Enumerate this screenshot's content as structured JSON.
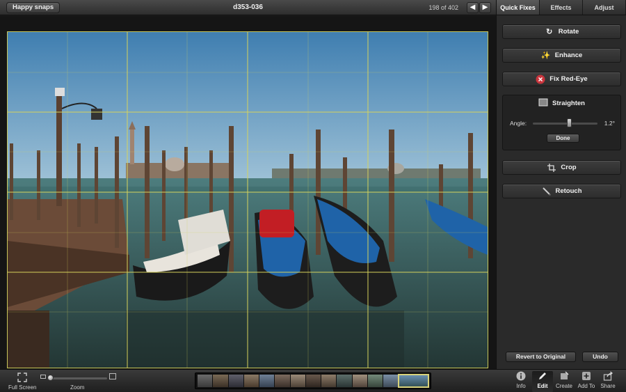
{
  "topbar": {
    "album_button": "Happy snaps",
    "photo_title": "d353-036",
    "counter": "198 of 402",
    "prev_icon": "left-arrow-icon",
    "next_icon": "right-arrow-icon"
  },
  "panel": {
    "tabs": [
      {
        "label": "Quick Fixes",
        "active": true
      },
      {
        "label": "Effects",
        "active": false
      },
      {
        "label": "Adjust",
        "active": false
      }
    ],
    "actions": {
      "rotate": "Rotate",
      "enhance": "Enhance",
      "fix_red_eye": "Fix Red-Eye",
      "straighten": "Straighten",
      "crop": "Crop",
      "retouch": "Retouch"
    },
    "straighten": {
      "angle_label": "Angle:",
      "angle_value": "1.2°",
      "done_label": "Done"
    },
    "revert_label": "Revert to Original",
    "undo_label": "Undo"
  },
  "bottombar": {
    "full_screen_label": "Full Screen",
    "zoom_label": "Zoom",
    "tools": {
      "info": "Info",
      "edit": "Edit",
      "create": "Create",
      "add_to": "Add To",
      "share": "Share"
    },
    "active_tool": "Edit"
  },
  "colors": {
    "grid_line": "#d6d35c",
    "sky": "#5f8fb3",
    "water": "#3f6a6c",
    "gondola_blue": "#1f63a8",
    "red_eye_badge": "#c9353d",
    "filmstrip_selected": "#d8d27a"
  }
}
